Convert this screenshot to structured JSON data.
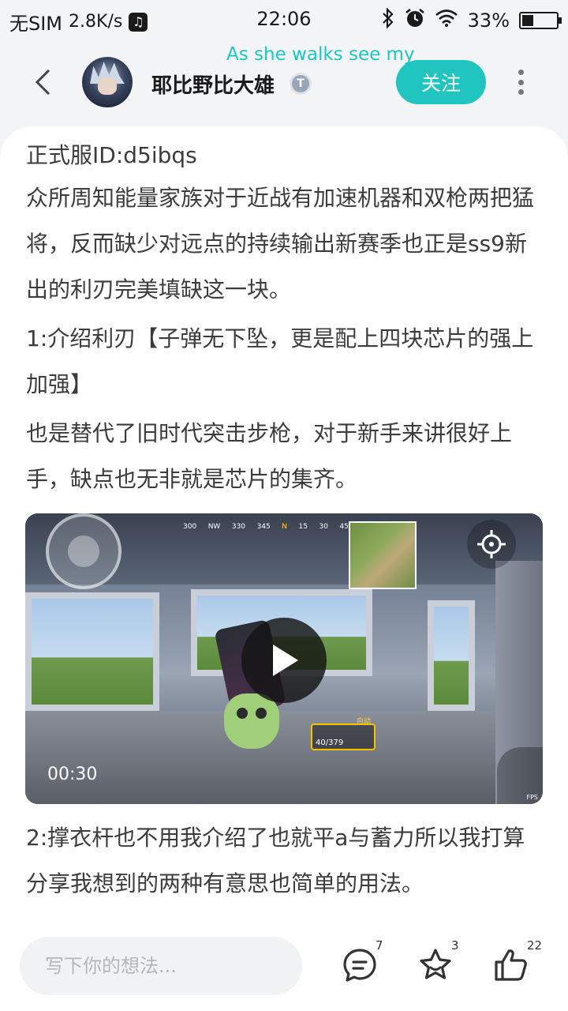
{
  "status_bar": {
    "carrier": "无SIM",
    "speed": "2.8K/s",
    "music_icon": "music-app-icon",
    "time": "22:06",
    "battery": "33%",
    "battery_level": 0.33,
    "icons": [
      "bluetooth-icon",
      "alarm-icon",
      "wifi-icon",
      "battery-icon"
    ]
  },
  "header": {
    "username": "耶比野比大雄",
    "badge": "T",
    "danmaku": "As she walks see my",
    "follow_label": "关注"
  },
  "post": {
    "line_id": "正式服ID:d5ibqs",
    "para1": "众所周知能量家族对于近战有加速机器和双枪两把猛将，反而缺少对远点的持续输出新赛季也正是ss9新出的利刃完美填缺这一块。",
    "para2": "1:介绍利刃【子弹无下坠，更是配上四块芯片的强上加强】",
    "para3": "也是替代了旧时代突击步枪，对于新手来讲很好上手，缺点也无非就是芯片的集齐。",
    "para4": "2:撑衣杆也不用我介绍了也就平a与蓄力所以我打算分享我想到的两种有意思也简单的用法。"
  },
  "video": {
    "duration": "00:30",
    "compass": [
      "300",
      "NW",
      "330",
      "345",
      "N",
      "15",
      "30",
      "45"
    ],
    "ammo": "40/379",
    "ammo_mode": "自动",
    "fps_label": "FPS"
  },
  "bottom": {
    "comment_placeholder": "写下你的想法...",
    "comments_count": "7",
    "favorites_count": "3",
    "likes_count": "22"
  },
  "colors": {
    "accent": "#20c5bf",
    "danmaku": "#1cc7c1",
    "text": "#3c3c3c"
  }
}
